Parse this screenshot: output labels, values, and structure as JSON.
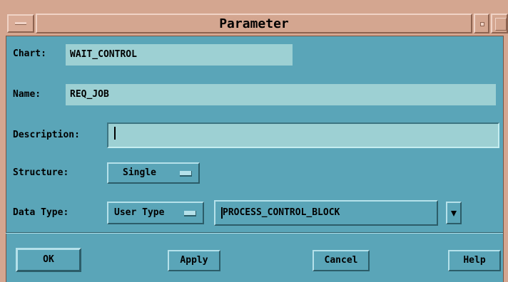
{
  "window": {
    "title": "Parameter"
  },
  "form": {
    "chart": {
      "label": "Chart:",
      "value": "WAIT_CONTROL"
    },
    "name": {
      "label": "Name:",
      "value": "REQ_JOB"
    },
    "description": {
      "label": "Description:",
      "value": ""
    },
    "structure": {
      "label": "Structure:",
      "selected": "Single"
    },
    "data_type": {
      "label": "Data Type:",
      "selected": "User Type",
      "value": "PROCESS_CONTROL_BLOCK"
    }
  },
  "buttons": {
    "ok": "OK",
    "apply": "Apply",
    "cancel": "Cancel",
    "help": "Help"
  },
  "icons": {
    "window_menu": "window-menu-icon",
    "minimize": "minimize-icon",
    "maximize": "maximize-icon",
    "dropdown": "chevron-down-icon",
    "option_menu": "option-menu-indicator-icon"
  }
}
